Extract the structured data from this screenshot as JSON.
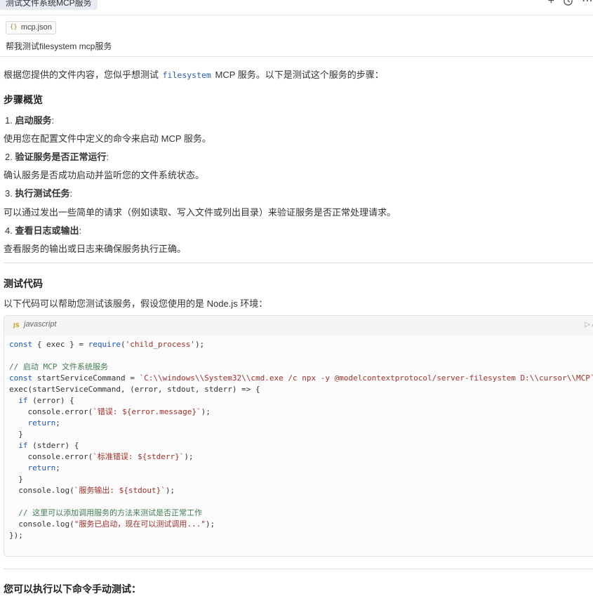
{
  "tab": {
    "title": "测试文件系统MCP服务"
  },
  "top_icons": [
    "plus-icon",
    "history-icon",
    "more-icon"
  ],
  "user_message": {
    "attachment": {
      "icon_glyph": "{}",
      "name": "mcp.json"
    },
    "text": "帮我测试filesystem mcp服务"
  },
  "answer": {
    "intro_pre": "根据您提供的文件内容，您似乎想测试 ",
    "intro_code": "filesystem",
    "intro_post": " MCP 服务。以下是测试这个服务的步骤：",
    "overview_heading": "步骤概览",
    "steps": [
      {
        "num": "1.",
        "title": "启动服务",
        "colon": ":",
        "desc": "使用您在配置文件中定义的命令来启动 MCP 服务。"
      },
      {
        "num": "2.",
        "title": "验证服务是否正常运行",
        "colon": ":",
        "desc": "确认服务是否成功启动并监听您的文件系统状态。"
      },
      {
        "num": "3.",
        "title": "执行测试任务",
        "colon": ":",
        "desc": "可以通过发出一些简单的请求（例如读取、写入文件或列出目录）来验证服务是否正常处理请求。"
      },
      {
        "num": "4.",
        "title": "查看日志或输出",
        "colon": ":",
        "desc": "查看服务的输出或日志来确保服务执行正确。"
      }
    ],
    "test_code_heading": "测试代码",
    "test_code_intro": "以下代码可以帮助您测试该服务，假设您使用的是 Node.js 环境：",
    "code_block": {
      "badge": "JS",
      "language": "javascript",
      "run_label": "▷ A",
      "lines": [
        "const { exec } = require('child_process');",
        "",
        "// 启动 MCP 文件系统服务",
        "const startServiceCommand = `C:\\\\windows\\\\System32\\\\cmd.exe /c npx -y @modelcontextprotocol/server-filesystem D:\\\\cursor\\\\MCP`",
        "exec(startServiceCommand, (error, stdout, stderr) => {",
        "  if (error) {",
        "    console.error(`错误: ${error.message}`);",
        "    return;",
        "  }",
        "  if (stderr) {",
        "    console.error(`标准错误: ${stderr}`);",
        "    return;",
        "  }",
        "  console.log(`服务输出: ${stdout}`);",
        "",
        "  // 这里可以添加调用服务的方法来测试是否正常工作",
        "  console.log(\"服务已启动，现在可以测试调用...\");",
        "});"
      ]
    },
    "manual_heading": "您可以执行以下命令手动测试："
  }
}
